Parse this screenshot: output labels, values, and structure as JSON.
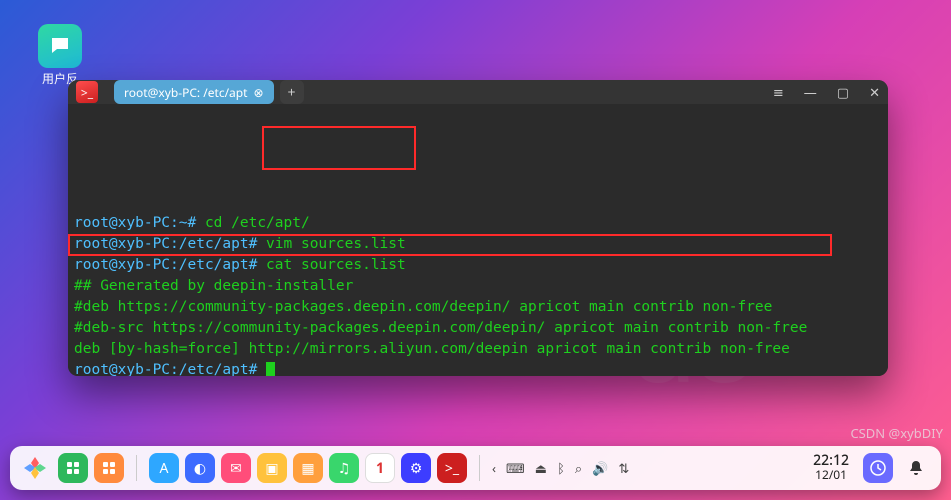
{
  "desktop": {
    "icon_label": "用户反",
    "icon_name": "feedback-icon"
  },
  "window": {
    "tabs": [
      {
        "title": "root@xyb-PC: /etc/apt"
      }
    ],
    "new_tab_label": "+",
    "controls": {
      "menu": "≡",
      "min": "—",
      "max": "▢",
      "close": "✕"
    }
  },
  "terminal": {
    "lines": [
      {
        "prompt": "root@xyb-PC:~#",
        "cmd": " cd /etc/apt/"
      },
      {
        "prompt": "root@xyb-PC:/etc/apt#",
        "cmd": " vim sources.list"
      },
      {
        "prompt": "root@xyb-PC:/etc/apt#",
        "cmd": " cat sources.list"
      },
      {
        "text": "## Generated by deepin-installer"
      },
      {
        "text": "#deb https://community-packages.deepin.com/deepin/ apricot main contrib non-free"
      },
      {
        "text": "#deb-src https://community-packages.deepin.com/deepin/ apricot main contrib non-free"
      },
      {
        "text": "deb [by-hash=force] http://mirrors.aliyun.com/deepin apricot main contrib non-free"
      },
      {
        "prompt": "root@xyb-PC:/etc/apt#",
        "cmd": " ",
        "cursor": true
      }
    ]
  },
  "dock": {
    "launcher": "launcher",
    "apps": [
      {
        "name": "multitask-icon",
        "color": "#2eb85c"
      },
      {
        "name": "desktop-icon",
        "color": "#ff8a3d"
      }
    ],
    "center": [
      {
        "name": "app-store-icon",
        "color": "#2ea7ff",
        "glyph": "A"
      },
      {
        "name": "browser-icon",
        "color": "#3d6bff",
        "glyph": "◐"
      },
      {
        "name": "mail-icon",
        "color": "#ff4d7a",
        "glyph": "✉"
      },
      {
        "name": "file-manager-icon",
        "color": "#ffc23d",
        "glyph": "▣"
      },
      {
        "name": "photos-icon",
        "color": "#ff9f3d",
        "glyph": "▦"
      },
      {
        "name": "music-icon",
        "color": "#39d66c",
        "glyph": "♫"
      },
      {
        "name": "calendar-icon",
        "color": "#ffffff",
        "glyph": "",
        "text": "1",
        "textColor": "#d33"
      },
      {
        "name": "control-center-icon",
        "color": "#3d3dff",
        "glyph": "⚙"
      },
      {
        "name": "terminal-icon",
        "color": "#cc1f1f",
        "glyph": ">_"
      }
    ],
    "tray": [
      {
        "name": "tray-chevron-icon",
        "glyph": "‹"
      },
      {
        "name": "keyboard-icon",
        "glyph": "⌨"
      },
      {
        "name": "usb-icon",
        "glyph": "⏏"
      },
      {
        "name": "bluetooth-icon",
        "glyph": "ᛒ"
      },
      {
        "name": "search-icon",
        "glyph": "⌕"
      },
      {
        "name": "volume-icon",
        "glyph": "🔊"
      },
      {
        "name": "network-icon",
        "glyph": "⇅"
      }
    ],
    "clock": {
      "time": "22:12",
      "date": "12/01"
    },
    "bell": "bell-icon"
  },
  "watermark": "CSDN @xybDIY",
  "brand": "de"
}
